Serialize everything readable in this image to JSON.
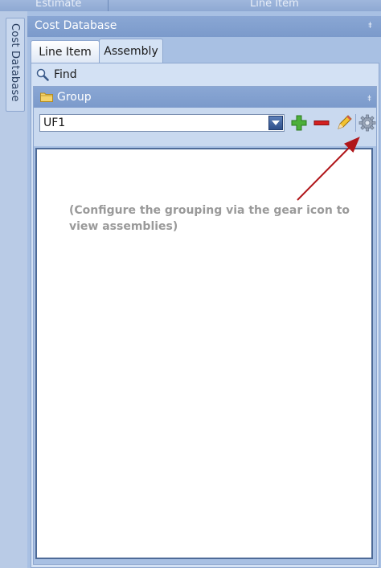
{
  "topbar": {
    "col1": "Estimate",
    "col2": "Line Item"
  },
  "side_tab": {
    "label": "Cost Database"
  },
  "panel": {
    "title": "Cost Database"
  },
  "tabs": [
    {
      "label": "Line Item",
      "active": false
    },
    {
      "label": "Assembly",
      "active": true
    }
  ],
  "find": {
    "label": "Find",
    "icon": "magnifier-icon"
  },
  "group": {
    "title": "Group",
    "icon": "folder-icon",
    "selected": "UF1",
    "buttons": [
      "add-icon",
      "remove-icon",
      "edit-icon",
      "gear-icon"
    ]
  },
  "list": {
    "hint": "(Configure the grouping via the gear icon to view assemblies)"
  },
  "colors": {
    "arrow": "#b0161a",
    "header": "#7b9acb",
    "accent_green": "#4caf3a",
    "accent_red": "#d32020"
  }
}
